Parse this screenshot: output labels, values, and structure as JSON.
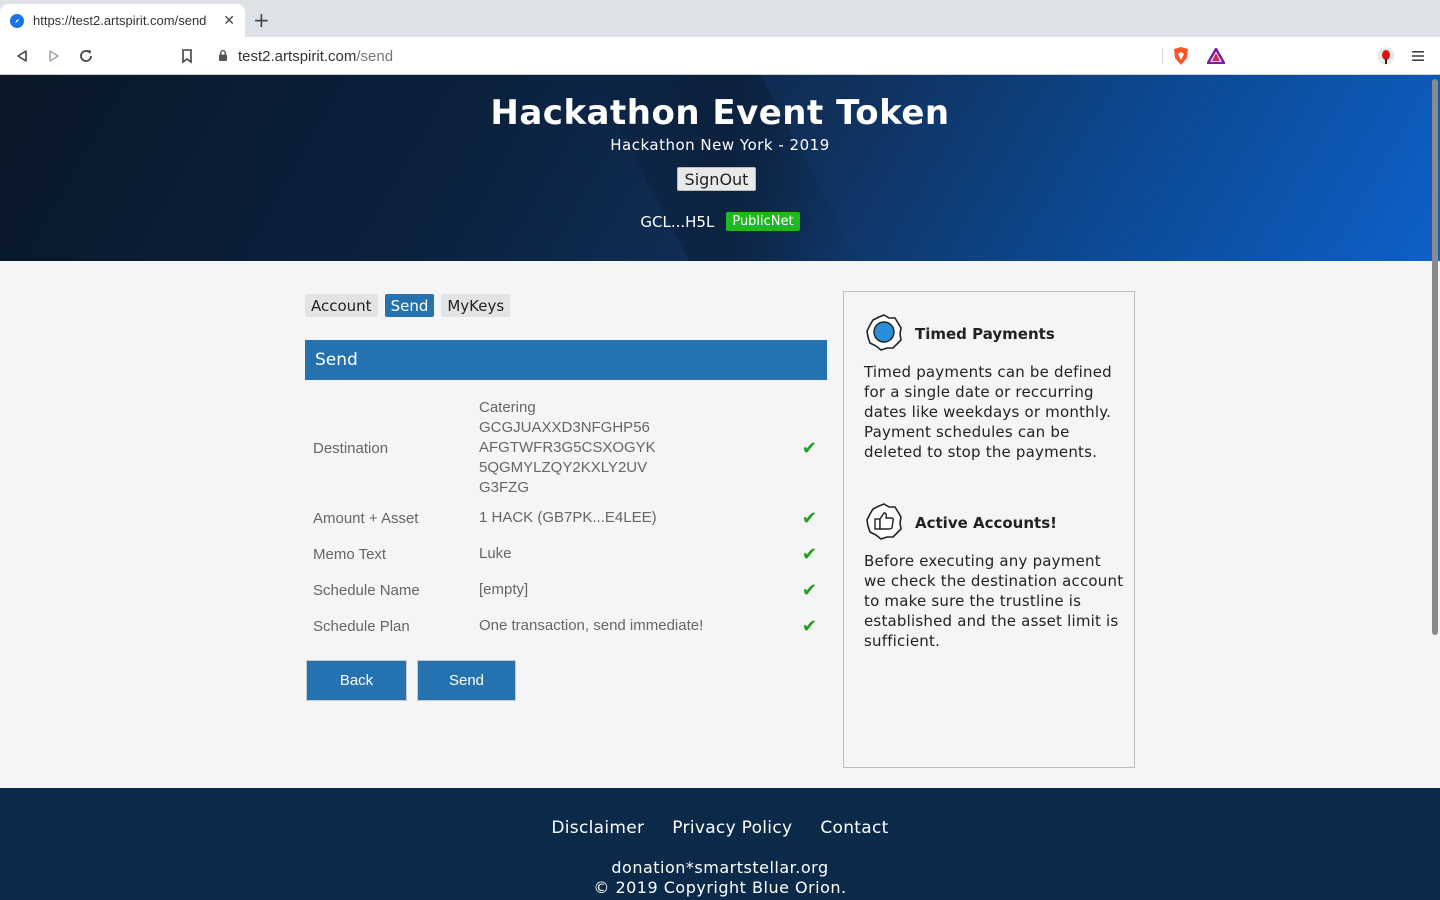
{
  "browser": {
    "tab_title": "https://test2.artspirit.com/send",
    "url_host": "test2.artspirit.com",
    "url_path": "/send"
  },
  "header": {
    "title": "Hackathon Event Token",
    "subtitle": "Hackathon New York - 2019",
    "signout_label": "SignOut",
    "account_id": "GCL...H5L",
    "network": "PublicNet"
  },
  "tabs": [
    {
      "label": "Account",
      "active": false
    },
    {
      "label": "Send",
      "active": true
    },
    {
      "label": "MyKeys",
      "active": false
    }
  ],
  "panel": {
    "title": "Send",
    "rows": [
      {
        "label": "Destination",
        "value": [
          "Catering",
          "GCGJUAXXD3NFGHP56",
          "AFGTWFR3G5CSXOGYK",
          "5QGMYLZQY2KXLY2UV",
          "G3FZG"
        ],
        "check": "✔"
      },
      {
        "label": "Amount + Asset",
        "value": [
          "1 HACK (GB7PK...E4LEE)"
        ],
        "check": "✔"
      },
      {
        "label": "Memo Text",
        "value": [
          "Luke"
        ],
        "check": "✔"
      },
      {
        "label": "Schedule Name",
        "value": [
          "[empty]"
        ],
        "check": "✔"
      },
      {
        "label": "Schedule Plan",
        "value": [
          "One transaction, send immediate!"
        ],
        "check": "✔"
      }
    ],
    "back_label": "Back",
    "send_label": "Send"
  },
  "sidebar": {
    "timed_title": "Timed Payments",
    "timed_body": "Timed payments can be defined for a single date or reccurring dates like weekdays or monthly. Payment schedules can be deleted to stop the payments.",
    "active_title": "Active Accounts!",
    "active_body": "Before executing any payment we check the destination account to make sure the trustline is established and the asset limit is sufficient."
  },
  "footer": {
    "links": [
      "Disclaimer",
      "Privacy Policy",
      "Contact"
    ],
    "donation": "donation*smartstellar.org",
    "copyright": "© 2019 Copyright Blue Orion."
  },
  "colors": {
    "accent": "#2472b0",
    "badge_green": "#1fb81f",
    "check_green": "#1fa01f",
    "footer_bg": "#0b2a4a"
  }
}
